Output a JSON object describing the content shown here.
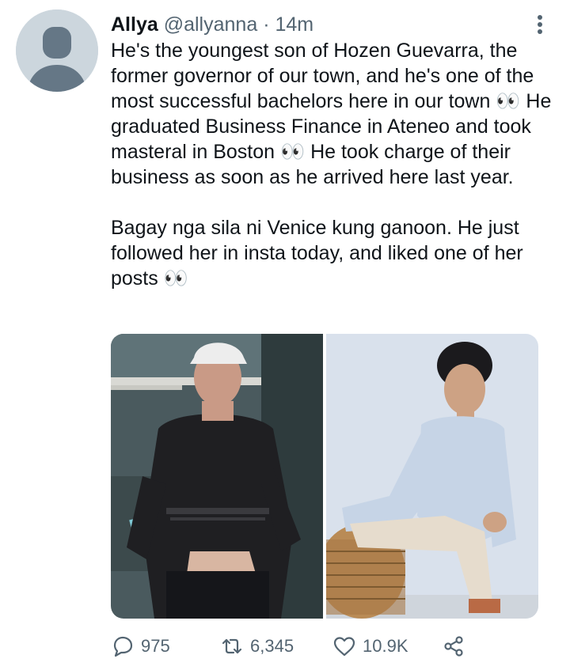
{
  "tweet": {
    "author_name": "Allya",
    "author_handle": "@allyanna",
    "separator": "·",
    "time": "14m",
    "text": "He's the youngest son of Hozen Guevarra, the former governor of our town, and he's one of the most successful bachelors here in our town 👀 He graduated Business Finance in Ateneo and took masteral in Boston 👀 He took charge of their business as soon as he arrived here last year.\n\nBagay nga sila ni Venice kung ganoon. He just followed her in insta today, and liked one of her posts 👀"
  },
  "actions": {
    "reply_count": "975",
    "retweet_count": "6,345",
    "like_count": "10.9K"
  },
  "icons": {
    "menu": "more-vertical-icon",
    "reply": "comment-icon",
    "retweet": "retweet-icon",
    "like": "heart-icon",
    "share": "share-icon"
  },
  "colors": {
    "text_primary": "#0f1419",
    "text_secondary": "#536471",
    "avatar_bg": "#ccd6dd",
    "avatar_fg": "#657786"
  }
}
